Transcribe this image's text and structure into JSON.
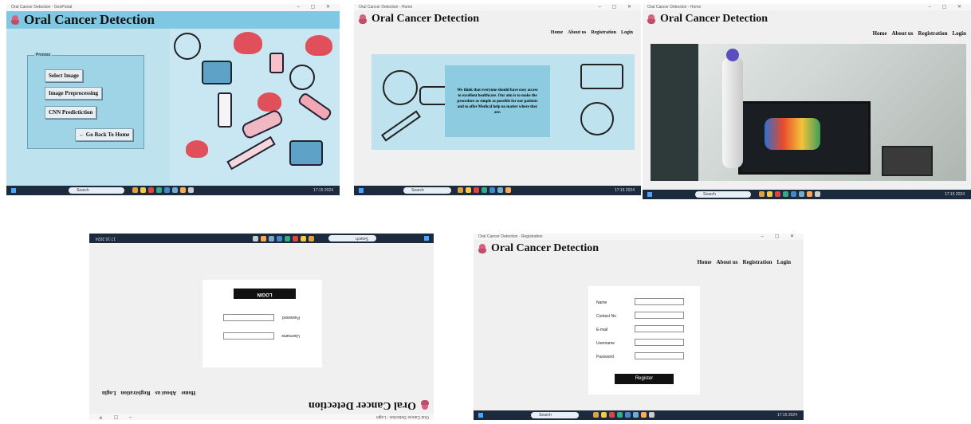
{
  "app": {
    "title": "Oral Cancer Detection"
  },
  "nav": [
    "Home",
    "About us",
    "Registration",
    "Login"
  ],
  "process": {
    "group_label": "Process",
    "buttons": [
      "Select Image",
      "Image Preprocessing",
      "CNN Predictiction",
      "← Go Back To Home"
    ]
  },
  "about": {
    "text": "We think that everyone should have easy access to excellent healthcare. Our aim is to make the procedure as simple as possible for our patients and to offer Medical help no matter where they are."
  },
  "login": {
    "title": "LOGIN",
    "fields": [
      "Username",
      "Password"
    ]
  },
  "registration": {
    "fields": [
      "Name",
      "Contact No",
      "E-mail",
      "Username",
      "Password"
    ],
    "submit": "Register"
  },
  "taskbar": {
    "search": "Search",
    "time": "17:15 2024"
  },
  "colors": {
    "sky": "#bfe2ef",
    "panel": "#9fd4e6",
    "taskbar": "#1c2a3e",
    "heart": "#e0505a",
    "logo": "#d9607e"
  }
}
